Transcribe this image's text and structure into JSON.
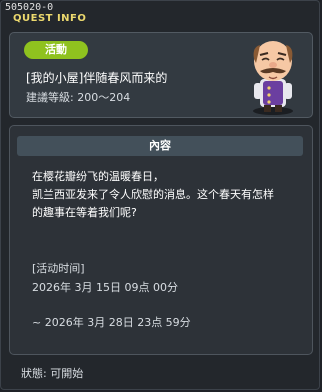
{
  "window": {
    "id_tag": "505020-0",
    "title": "QUEST INFO"
  },
  "quest": {
    "badge": "活動",
    "name": "[我的小屋]伴随春风而来的",
    "level": "建議等級: 200～204"
  },
  "content": {
    "header": "內容",
    "description_lines": [
      "在樱花瓣纷飞的温暖春日，",
      "凯兰西亚发来了令人欣慰的消息。这个春天有怎样",
      "的趣事在等着我们呢?"
    ],
    "time_label": "[活动时间]",
    "time_start": "2026年 3月 15日 09点 00分",
    "time_end": "~ 2026年 3月 28日 23点 59分"
  },
  "status": "狀態:  可開始",
  "colors": {
    "title": "#ecd96e",
    "badge": "#8fc21f",
    "npc_vest": "#6b3fa0"
  },
  "icons": {
    "npc": "npc-portrait-icon"
  }
}
